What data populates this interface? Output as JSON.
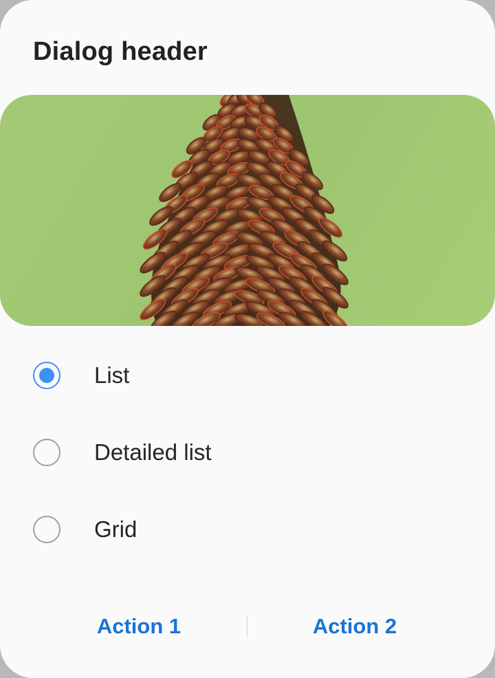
{
  "dialog": {
    "header": "Dialog header",
    "image": {
      "subject": "pine-cone-photo",
      "background_color": "#9fc672"
    },
    "options": [
      {
        "label": "List",
        "selected": true
      },
      {
        "label": "Detailed list",
        "selected": false
      },
      {
        "label": "Grid",
        "selected": false
      }
    ],
    "actions": [
      {
        "label": "Action 1"
      },
      {
        "label": "Action 2"
      }
    ]
  },
  "colors": {
    "accent": "#3e91f4",
    "action_text": "#1a73d6",
    "text_primary": "#222222",
    "dialog_background": "#fafafa"
  }
}
